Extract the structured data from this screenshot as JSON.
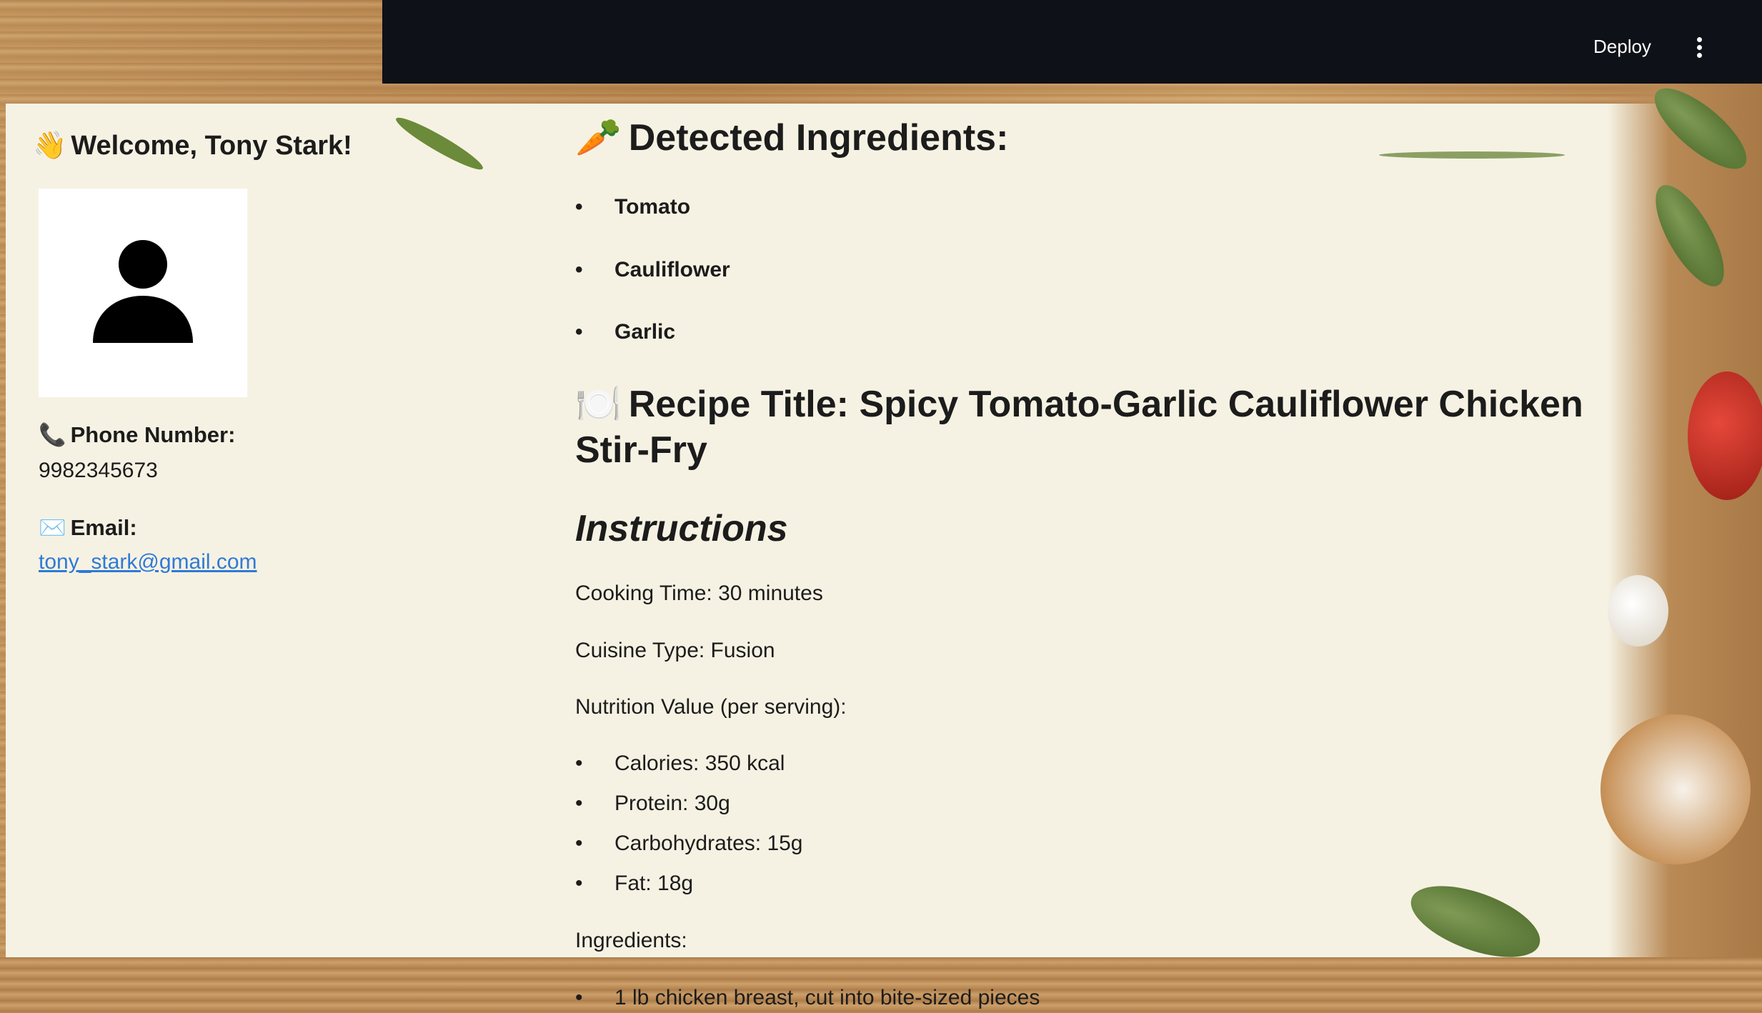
{
  "header": {
    "deploy_label": "Deploy",
    "menu_icon": "kebab-menu-icon"
  },
  "sidebar": {
    "welcome_emoji": "👋",
    "welcome_text": "Welcome, Tony Stark!",
    "avatar_icon": "user-avatar-icon",
    "phone_emoji": "📞",
    "phone_label": "Phone Number:",
    "phone_value": "9982345673",
    "email_emoji": "✉️",
    "email_label": "Email:",
    "email_value": "tony_stark@gmail.com"
  },
  "main": {
    "detected_emoji": "🥕",
    "detected_title": "Detected Ingredients:",
    "detected_ingredients": [
      "Tomato",
      "Cauliflower",
      "Garlic"
    ],
    "recipe_emoji": "🍽️",
    "recipe_title": "Recipe Title: Spicy Tomato-Garlic Cauliflower Chicken Stir-Fry",
    "instructions_heading": "Instructions",
    "cooking_time": "Cooking Time: 30 minutes",
    "cuisine_type": "Cuisine Type: Fusion",
    "nutrition_heading": "Nutrition Value (per serving):",
    "nutrition": [
      "Calories: 350 kcal",
      "Protein: 30g",
      "Carbohydrates: 15g",
      "Fat: 18g"
    ],
    "ingredients_heading": "Ingredients:",
    "ingredients": [
      "1 lb chicken breast, cut into bite-sized pieces"
    ]
  },
  "colors": {
    "header_bg": "#0e1117",
    "panel_bg": "#f6f2e3",
    "link": "#2f7ad6"
  }
}
